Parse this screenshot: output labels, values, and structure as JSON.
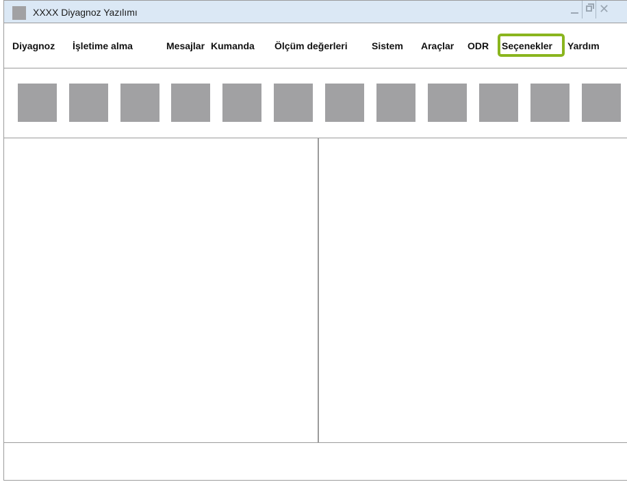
{
  "window": {
    "title": "XXXX Diyagnoz Yazılımı",
    "controls": {
      "close_symbol": "✕"
    }
  },
  "menu": {
    "items": [
      {
        "label": "Diyagnoz"
      },
      {
        "label": "İşletime alma"
      },
      {
        "label": "Mesajlar"
      },
      {
        "label": "Kumanda"
      },
      {
        "label": "Ölçüm değerleri"
      },
      {
        "label": "Sistem"
      },
      {
        "label": "Araçlar"
      },
      {
        "label": "ODR"
      },
      {
        "label": "Seçenekler",
        "highlighted": true
      },
      {
        "label": "Yardım"
      }
    ],
    "highlight_color": "#8ab51e"
  },
  "toolbar": {
    "button_count": 12,
    "button_color": "#a1a1a3"
  }
}
